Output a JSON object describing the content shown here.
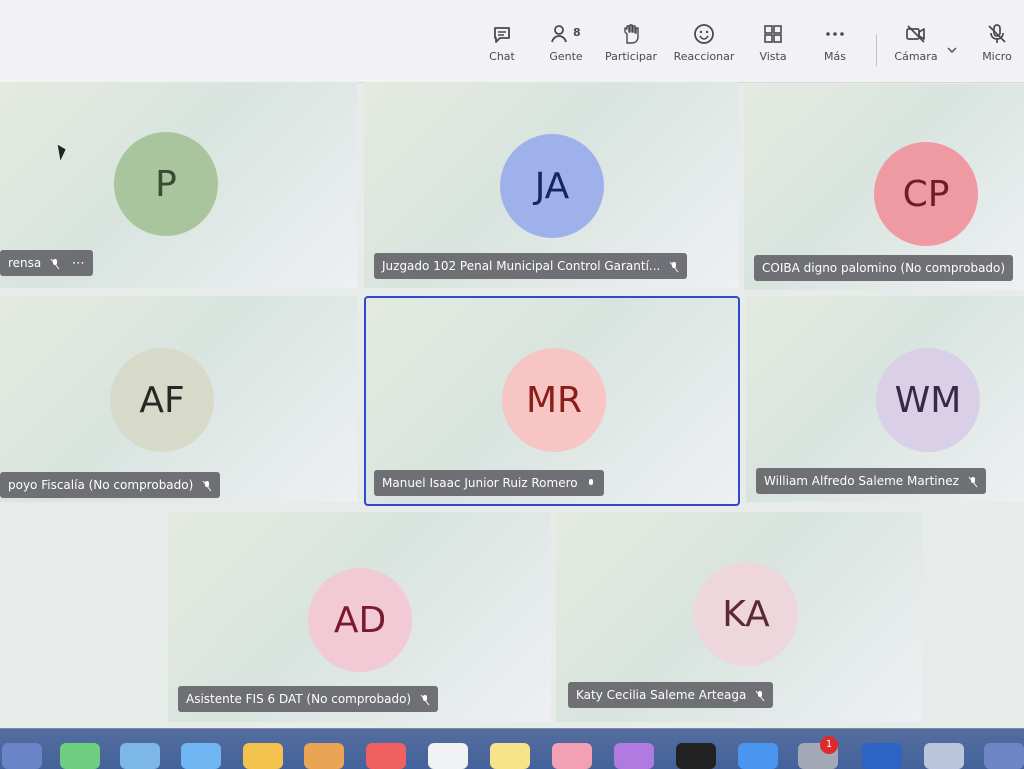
{
  "toolbar": {
    "chat": "Chat",
    "people": "Gente",
    "people_count": "8",
    "participate": "Participar",
    "react": "Reaccionar",
    "view": "Vista",
    "more": "Más",
    "camera": "Cámara",
    "mic": "Micro"
  },
  "tiles": [
    {
      "initials": "P",
      "name": "rensa",
      "avatar_bg": "#a9c59d",
      "avatar_fg": "#3a4b35"
    },
    {
      "initials": "JA",
      "name": "Juzgado 102 Penal Municipal Control Garantí...",
      "avatar_bg": "#9eb1ea",
      "avatar_fg": "#19255f"
    },
    {
      "initials": "CP",
      "name": "COIBA digno palomino (No comprobado)",
      "avatar_bg": "#ef9aa3",
      "avatar_fg": "#6d1d29"
    },
    {
      "initials": "AF",
      "name": "poyo Fiscalía (No comprobado)",
      "avatar_bg": "#d7dac9",
      "avatar_fg": "#252825"
    },
    {
      "initials": "MR",
      "name": "Manuel Isaac Junior Ruiz Romero",
      "avatar_bg": "#f6c5c4",
      "avatar_fg": "#8a1f17"
    },
    {
      "initials": "WM",
      "name": "William Alfredo Saleme Martinez",
      "avatar_bg": "#d9cfe7",
      "avatar_fg": "#352a4a"
    },
    {
      "initials": "AD",
      "name": "Asistente FIS 6 DAT (No comprobado)",
      "avatar_bg": "#f2cad6",
      "avatar_fg": "#7b1a2f"
    },
    {
      "initials": "KA",
      "name": "Katy Cecilia Saleme Arteaga",
      "avatar_bg": "#eed7dc",
      "avatar_fg": "#5b2b31"
    }
  ],
  "dock": {
    "notification_count": "1"
  }
}
